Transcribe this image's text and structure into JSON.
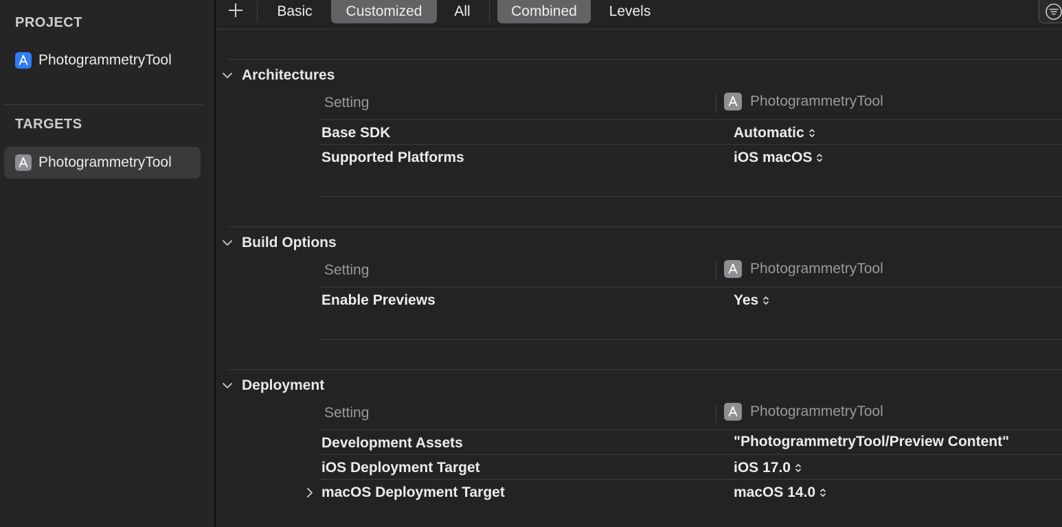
{
  "sidebar": {
    "project_heading": "PROJECT",
    "project_item": "PhotogrammetryTool",
    "targets_heading": "TARGETS",
    "target_item": "PhotogrammetryTool"
  },
  "toolbar": {
    "add_label": "+",
    "segments_view": [
      "Basic",
      "Customized",
      "All"
    ],
    "segments_mode": [
      "Combined",
      "Levels"
    ],
    "selected_view": "Customized",
    "selected_mode": "Combined"
  },
  "sections": {
    "architectures": {
      "title": "Architectures",
      "setting_header": "Setting",
      "target_header": "PhotogrammetryTool",
      "rows": [
        {
          "name": "Base SDK",
          "value": "Automatic"
        },
        {
          "name": "Supported Platforms",
          "value": "iOS macOS"
        }
      ]
    },
    "build_options": {
      "title": "Build Options",
      "setting_header": "Setting",
      "target_header": "PhotogrammetryTool",
      "rows": [
        {
          "name": "Enable Previews",
          "value": "Yes"
        }
      ]
    },
    "deployment": {
      "title": "Deployment",
      "setting_header": "Setting",
      "target_header": "PhotogrammetryTool",
      "rows": [
        {
          "name": "Development Assets",
          "value": "\"PhotogrammetryTool/Preview Content\""
        },
        {
          "name": "iOS Deployment Target",
          "value": "iOS 17.0"
        },
        {
          "name": "macOS Deployment Target",
          "value": "macOS 14.0"
        }
      ]
    }
  },
  "icons": {
    "add": "plus-icon",
    "filter": "filter-icon",
    "project": "app-project-icon",
    "target": "app-target-icon",
    "disclosure_open": "chevron-down-icon",
    "disclosure_closed": "chevron-right-icon",
    "stepper": "up-down-stepper-icon"
  },
  "colors": {
    "background": "#232323",
    "sidebar": "#252526",
    "selection": "#3a3a3c",
    "segment_on": "#636366",
    "project_icon": "#2f7cf6",
    "target_icon": "#8e8e93"
  }
}
